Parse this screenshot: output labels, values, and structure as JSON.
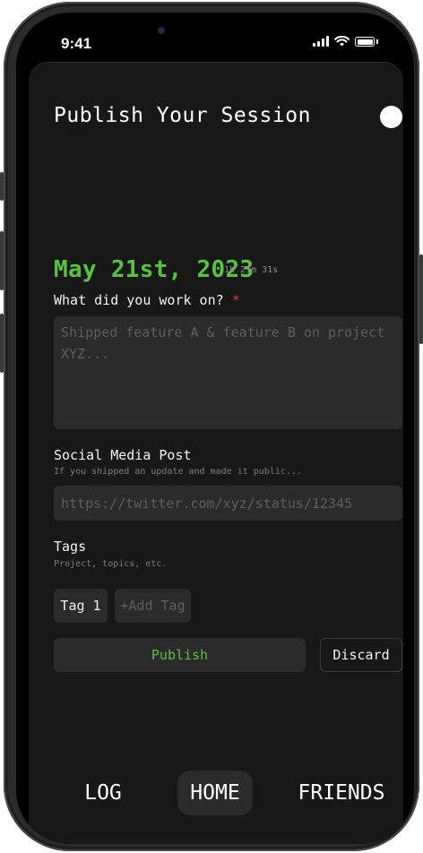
{
  "status_bar": {
    "time": "9:41",
    "icons": [
      "cellular-signal-icon",
      "wifi-icon",
      "battery-icon"
    ]
  },
  "header": {
    "title": "Publish Your Session",
    "toggle_icon": "circle-toggle-icon"
  },
  "session": {
    "date": "May 21st, 2023",
    "duration": "1h 21m 31s"
  },
  "work_field": {
    "label": "What did you work on?",
    "required_marker": "*",
    "placeholder": "Shipped feature A & feature B on project XYZ...",
    "value": ""
  },
  "social_field": {
    "label": "Social Media Post",
    "helper": "If you shipped an update and made it public...",
    "placeholder": "https://twitter.com/xyz/status/12345",
    "value": ""
  },
  "tags": {
    "label": "Tags",
    "helper": "Project, topics, etc.",
    "items": [
      "Tag 1"
    ],
    "add_label": "+Add Tag"
  },
  "actions": {
    "publish_label": "Publish",
    "discard_label": "Discard"
  },
  "bottom_nav": {
    "items": [
      "LOG",
      "HOME",
      "FRIENDS"
    ],
    "active": "HOME"
  },
  "colors": {
    "accent_green": "#57c23d",
    "required_red": "#d2303a",
    "background": "#181818",
    "field": "#2b2b2b"
  }
}
